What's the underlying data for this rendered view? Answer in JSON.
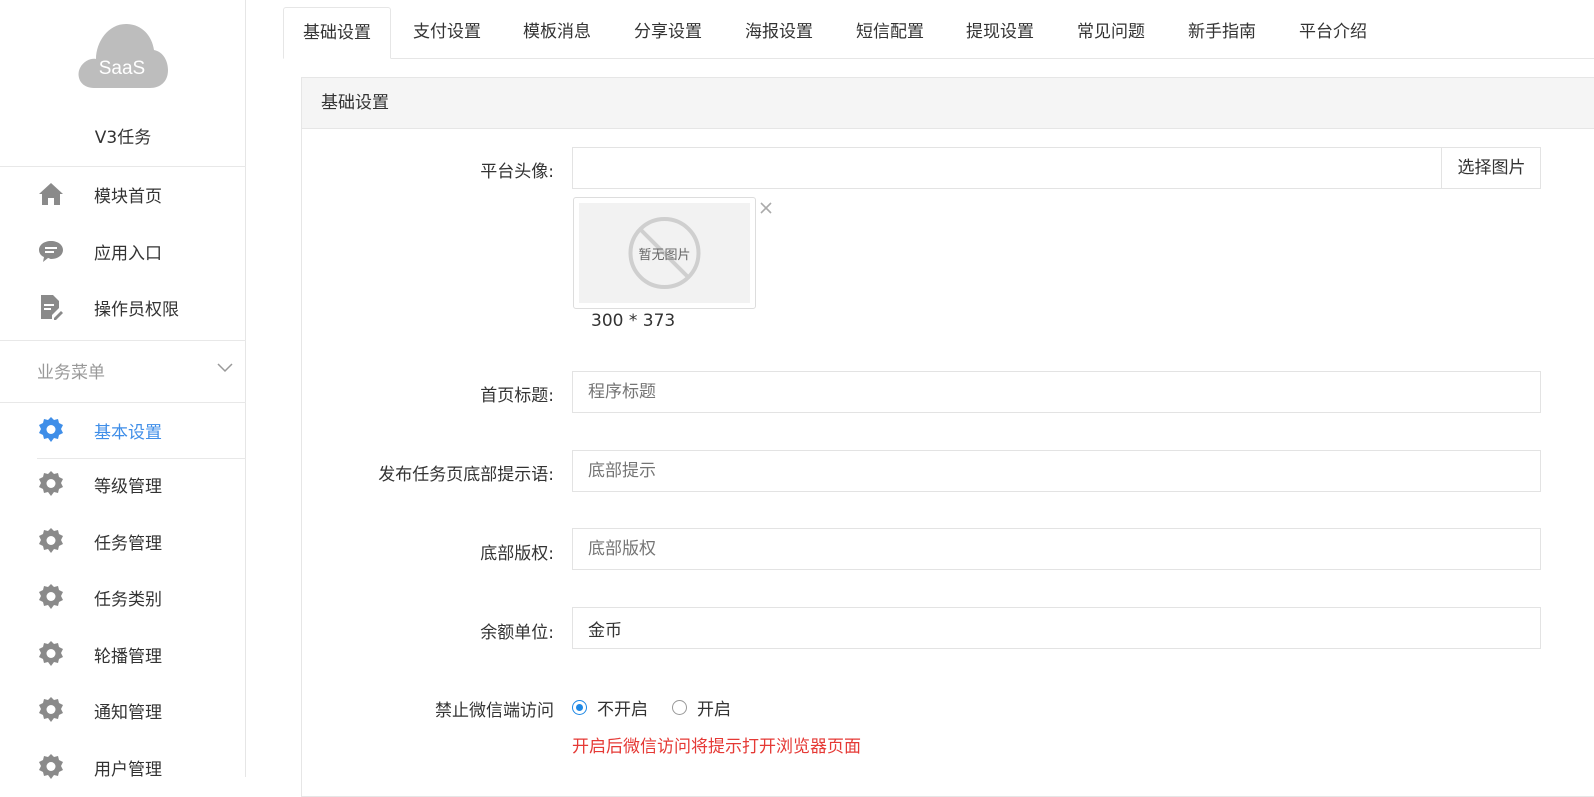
{
  "sidebar": {
    "logo_text": "SaaS",
    "app_name": "V3任务",
    "top_items": [
      {
        "label": "模块首页",
        "icon": "home-icon"
      },
      {
        "label": "应用入口",
        "icon": "chat-icon"
      },
      {
        "label": "操作员权限",
        "icon": "document-edit-icon"
      }
    ],
    "section_title": "业务菜单",
    "menu_items": [
      {
        "label": "基本设置",
        "icon": "gear-icon",
        "active": true
      },
      {
        "label": "等级管理",
        "icon": "gear-icon"
      },
      {
        "label": "任务管理",
        "icon": "gear-icon"
      },
      {
        "label": "任务类别",
        "icon": "gear-icon"
      },
      {
        "label": "轮播管理",
        "icon": "gear-icon"
      },
      {
        "label": "通知管理",
        "icon": "gear-icon"
      },
      {
        "label": "用户管理",
        "icon": "gear-icon"
      }
    ]
  },
  "tabs": [
    "基础设置",
    "支付设置",
    "模板消息",
    "分享设置",
    "海报设置",
    "短信配置",
    "提现设置",
    "常见问题",
    "新手指南",
    "平台介绍"
  ],
  "panel": {
    "title": "基础设置",
    "avatar_label": "平台头像:",
    "avatar_value": "",
    "pick_button": "选择图片",
    "no_image_text": "暂无图片",
    "image_size": "300 * 373",
    "fields": [
      {
        "label": "首页标题:",
        "placeholder": "程序标题",
        "value": ""
      },
      {
        "label": "发布任务页底部提示语:",
        "placeholder": "底部提示",
        "value": ""
      },
      {
        "label": "底部版权:",
        "placeholder": "底部版权",
        "value": ""
      },
      {
        "label": "余额单位:",
        "placeholder": "",
        "value": "金币"
      }
    ],
    "wechat_label": "禁止微信端访问",
    "radio_off": "不开启",
    "radio_on": "开启",
    "wechat_hint": "开启后微信访问将提示打开浏览器页面"
  },
  "colors": {
    "accent": "#3f8ee8",
    "icon_gray": "#8a8a8a",
    "hint_red": "#e53935",
    "logo_gray": "#bdbdbd"
  }
}
